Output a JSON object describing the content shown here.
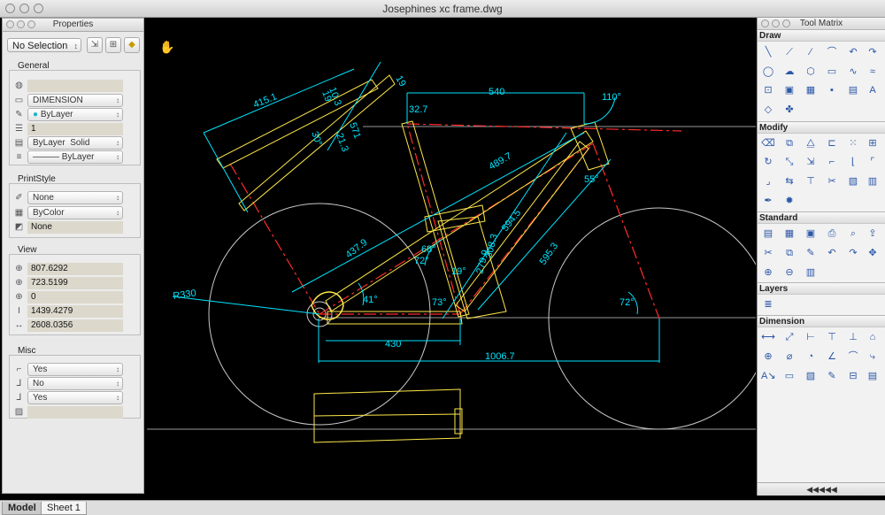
{
  "window": {
    "title": "Josephines xc frame.dwg"
  },
  "properties": {
    "title": "Properties",
    "selection": "No Selection",
    "groups": {
      "general": {
        "label": "General",
        "color_value": "",
        "layer": "DIMENSION",
        "color": "ByLayer",
        "scale": "1",
        "linetype": "ByLayer",
        "linetype_style": "Solid",
        "lineweight": "ByLayer"
      },
      "printstyle": {
        "label": "PrintStyle",
        "style": "None",
        "color": "ByColor",
        "value": "None"
      },
      "view": {
        "label": "View",
        "values": [
          "807.6292",
          "723.5199",
          "0",
          "1439.4279",
          "2608.0356"
        ]
      },
      "misc": {
        "label": "Misc",
        "values": [
          "Yes",
          "No",
          "Yes",
          ""
        ]
      }
    }
  },
  "tool_matrix": {
    "title": "Tool Matrix",
    "sections": [
      "Draw",
      "Modify",
      "Standard",
      "Layers",
      "Dimension"
    ],
    "footer": "◀◀◀◀◀"
  },
  "drawing": {
    "dimensions": [
      "540",
      "110°",
      "32.7",
      "415.1",
      "19",
      "10.3",
      "571",
      "21.3",
      "19",
      "30°",
      "489.7",
      "594.5",
      "55°",
      "595.3",
      "437.9",
      "68°",
      "72°",
      "19°",
      "279.9",
      "308.3",
      "73°",
      "72°",
      "R330",
      "41°",
      "430",
      "1006.7"
    ]
  },
  "tabs": [
    "Model",
    "Sheet 1"
  ],
  "colors": {
    "canvas": "#000000",
    "dim": "#00e5ff",
    "frame": "#ffe84a",
    "center": "#ff2b2b",
    "wheel": "#c8c8c8"
  }
}
